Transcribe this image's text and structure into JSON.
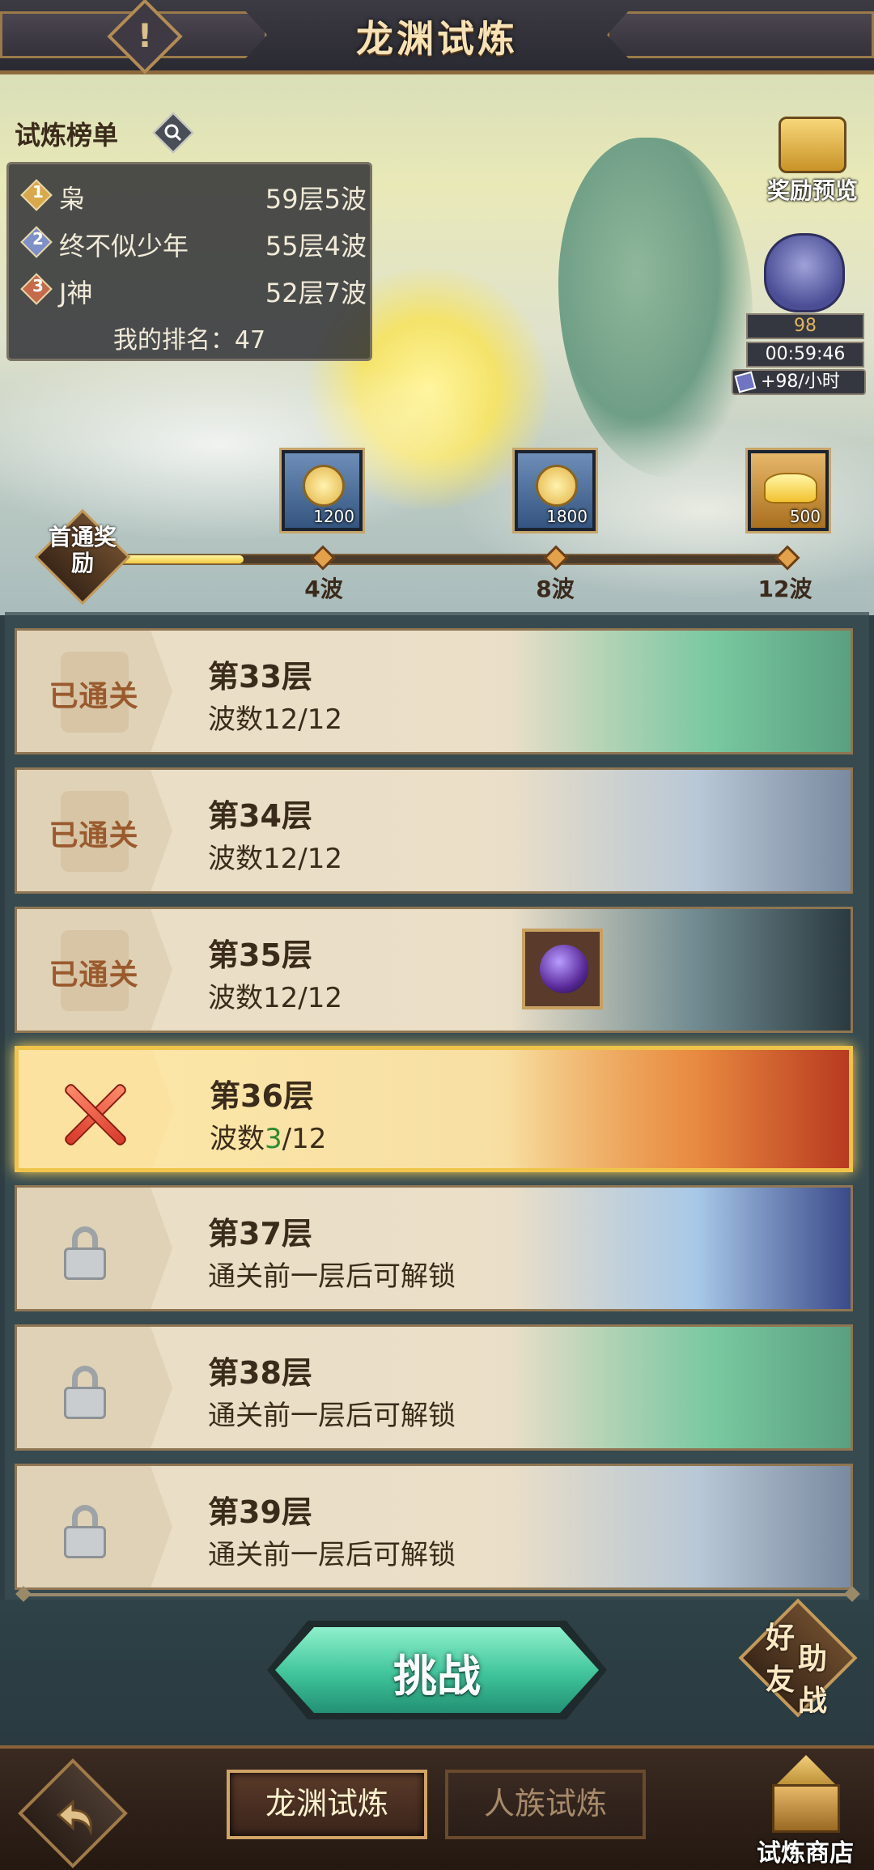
{
  "header": {
    "title": "龙渊试炼",
    "info_icon": "exclamation-icon"
  },
  "ranking": {
    "title": "试炼榜单",
    "entries": [
      {
        "rank": "1",
        "name": "枭",
        "score": "59层5波",
        "color": "#d8a84a"
      },
      {
        "rank": "2",
        "name": "终不似少年",
        "score": "55层4波",
        "color": "#7f8fc9"
      },
      {
        "rank": "3",
        "name": "J神",
        "score": "52层7波",
        "color": "#c56a4a"
      }
    ],
    "my_rank": "我的排名：47"
  },
  "side": {
    "reward_preview_label": "奖励预览",
    "bag_count": "98",
    "bag_timer": "00:59:46",
    "bag_rate": "+98/小时"
  },
  "first_clear": {
    "label": "首通奖励",
    "progress": 0.19,
    "milestones": [
      {
        "label": "4波",
        "qty": "1200"
      },
      {
        "label": "8波",
        "qty": "1800"
      },
      {
        "label": "12波",
        "qty": "500"
      }
    ]
  },
  "levels": [
    {
      "name": "第33层",
      "status": "已通关",
      "sub_prefix": "波数",
      "waves_done": "12",
      "waves_total": "/12",
      "state": "cleared",
      "accent": "#78c8a0"
    },
    {
      "name": "第34层",
      "status": "已通关",
      "sub_prefix": "波数",
      "waves_done": "12",
      "waves_total": "/12",
      "state": "cleared",
      "accent": "#9fb4c8"
    },
    {
      "name": "第35层",
      "status": "已通关",
      "sub_prefix": "波数",
      "waves_done": "12",
      "waves_total": "/12",
      "state": "cleared",
      "accent": "#5a7a80"
    },
    {
      "name": "第36层",
      "status": "",
      "sub_prefix": "波数",
      "waves_done": "3",
      "waves_total": "/12",
      "state": "current",
      "accent": "#e07a3a"
    },
    {
      "name": "第37层",
      "status": "",
      "sub_text": "通关前一层后可解锁",
      "state": "locked",
      "accent": "#7aa8d8"
    },
    {
      "name": "第38层",
      "status": "",
      "sub_text": "通关前一层后可解锁",
      "state": "locked",
      "accent": "#78c8a0"
    },
    {
      "name": "第39层",
      "status": "",
      "sub_text": "通关前一层后可解锁",
      "state": "locked",
      "accent": "#9fb4c8"
    }
  ],
  "actions": {
    "challenge_label": "挑战",
    "friend_label_1": "好",
    "friend_label_2": "助",
    "friend_label_3": "友",
    "friend_label_4": "战"
  },
  "bottom": {
    "tabs": [
      {
        "label": "龙渊试炼",
        "active": true
      },
      {
        "label": "人族试炼",
        "active": false
      }
    ],
    "shop_label": "试炼商店"
  }
}
